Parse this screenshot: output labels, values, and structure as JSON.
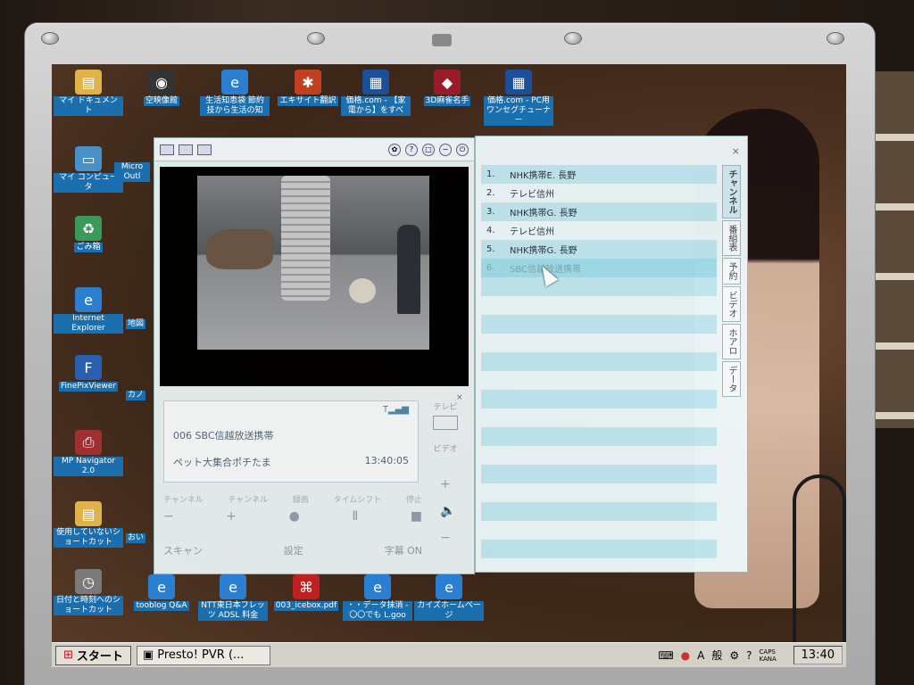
{
  "desktop_icons_top": [
    {
      "label": "マイ ドキュメント",
      "icon": "folder-icon"
    },
    {
      "label": "空映像館",
      "icon": "camera-icon"
    },
    {
      "label": "生活知恵袋 節約技から生活の知",
      "icon": "ie-icon"
    },
    {
      "label": "エキサイト翻訳",
      "icon": "translate-icon"
    },
    {
      "label": "価格.com - 【家電から】をすべ",
      "icon": "shortcut-icon"
    },
    {
      "label": "3D麻雀名手",
      "icon": "mahjong-icon"
    },
    {
      "label": "価格.com - PC用ワンセグチューナー",
      "icon": "shortcut-icon"
    }
  ],
  "desktop_icons_left": [
    {
      "label": "マイ コンピュータ",
      "icon": "computer-icon"
    },
    {
      "label": "ごみ箱",
      "icon": "recycle-icon"
    },
    {
      "label": "Internet Explorer",
      "icon": "ie-icon"
    },
    {
      "label": "FinePixViewer",
      "icon": "finepix-icon"
    },
    {
      "label": "MP Navigator 2.0",
      "icon": "printer-icon"
    },
    {
      "label": "使用していないショートカット",
      "icon": "folder-icon"
    }
  ],
  "desktop_icons_left2": [
    {
      "label": "Micro Outl"
    },
    {
      "label": "地図"
    },
    {
      "label": "カノ"
    },
    {
      "label": "おい"
    }
  ],
  "desktop_icons_bottom": [
    {
      "label": "日付と時刻へのショートカット",
      "icon": "clock-icon"
    },
    {
      "label": "tooblog Q&A",
      "icon": "ie-icon"
    },
    {
      "label": "NTT東日本フレッツ ADSL 料金",
      "icon": "ie-icon"
    },
    {
      "label": "003_icebox.pdf",
      "icon": "pdf-icon"
    },
    {
      "label": "・・データ抹消 - 〇〇でも L.goo",
      "icon": "ie-icon"
    },
    {
      "label": "カイズホームページ",
      "icon": "ie-icon"
    }
  ],
  "player": {
    "channel_name": "006 SBC信越放送携帯",
    "program": "ペット大集合ポチたま",
    "time": "13:40:05",
    "tv_label": "テレビ",
    "video_label": "ビデオ",
    "ctrl_labels": [
      "チャンネル",
      "チャンネル",
      "録画",
      "タイムシフト",
      "停止"
    ],
    "ctrl_symbols": [
      "−",
      "+",
      "●",
      "Ⅱ",
      "■"
    ],
    "scan_label": "スキャン",
    "settings_label": "設定",
    "subtitle_label": "字幕 ON",
    "vol_plus": "+",
    "vol_minus": "−",
    "title_buttons": [
      "?",
      "□",
      "−",
      "×"
    ]
  },
  "channel_window": {
    "items": [
      {
        "num": "1.",
        "name": "NHK携帯E. 長野"
      },
      {
        "num": "2.",
        "name": "テレビ信州"
      },
      {
        "num": "3.",
        "name": "NHK携帯G. 長野"
      },
      {
        "num": "4.",
        "name": "テレビ信州"
      },
      {
        "num": "5.",
        "name": "NHK携帯G. 長野"
      },
      {
        "num": "6.",
        "name": "SBC信越放送携帯"
      }
    ],
    "tabs": [
      "チャンネル",
      "番組表",
      "予約",
      "ビデオ",
      "ホアロ",
      "データ"
    ],
    "close": "×"
  },
  "taskbar": {
    "start_label": "スタート",
    "task_label": "Presto! PVR (...",
    "tray_items": [
      "A",
      "般"
    ],
    "caps": "CAPS KANA",
    "clock": "13:40"
  }
}
